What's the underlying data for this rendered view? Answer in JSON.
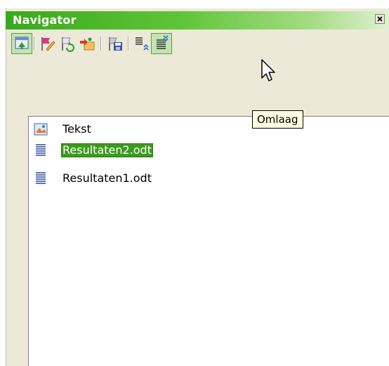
{
  "window": {
    "title": "Navigator",
    "close_icon": "close-icon"
  },
  "toolbar": {
    "buttons": [
      {
        "name": "navigation-toggle-button",
        "icon": "navigation-icon",
        "pressed": true
      },
      {
        "name": "edit-button",
        "icon": "edit-pencil-icon"
      },
      {
        "name": "update-button",
        "icon": "update-flag-icon"
      },
      {
        "name": "insert-button",
        "icon": "insert-icon"
      },
      {
        "name": "save-as-button",
        "icon": "save-as-icon"
      },
      {
        "name": "move-up-button",
        "icon": "move-up-icon"
      },
      {
        "name": "move-down-button",
        "icon": "move-down-icon",
        "pressed": true
      }
    ],
    "tooltip": "Omlaag"
  },
  "tree": {
    "items": [
      {
        "label": "Tekst",
        "icon": "text-section-icon",
        "selected": false
      },
      {
        "label": "Resultaten2.odt",
        "icon": "document-lines-icon",
        "selected": true
      },
      {
        "label": "Resultaten1.odt",
        "icon": "document-lines-icon",
        "selected": false
      }
    ]
  },
  "colors": {
    "title_bar": "#3aa81e",
    "selection": "#3c9a1e",
    "tooltip_bg": "#ffffe1",
    "panel_bg": "#ece9d8"
  }
}
